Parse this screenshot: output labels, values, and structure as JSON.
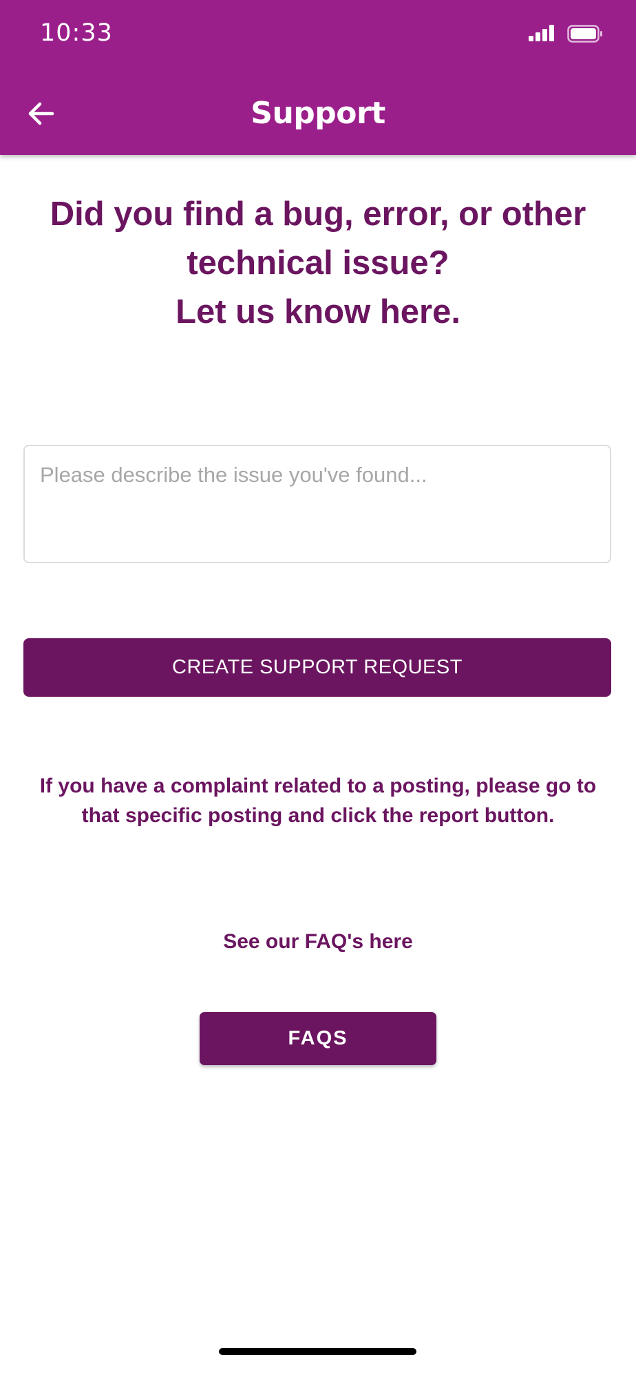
{
  "status_bar": {
    "time": "10:33",
    "icons": [
      "signal-icon",
      "battery-icon"
    ]
  },
  "header": {
    "title": "Support",
    "back_icon": "arrow-left-icon",
    "background_color": "#9b1f8b"
  },
  "main": {
    "heading_line1": "Did you find a bug, error, or other",
    "heading_line2": "technical issue?",
    "heading_line3": "Let us know here.",
    "issue_input": {
      "value": "",
      "placeholder": "Please describe the issue you've found..."
    },
    "create_button_label": "CREATE SUPPORT REQUEST",
    "complaint_text": "If you have a complaint related to a posting, please go to that specific posting and click the report button.",
    "faq_caption": "See our FAQ's here",
    "faqs_button_label": "FAQS"
  },
  "colors": {
    "accent": "#6b1560",
    "header": "#9b1f8b",
    "border": "#dcdcdc",
    "placeholder": "#a7a7a7"
  }
}
